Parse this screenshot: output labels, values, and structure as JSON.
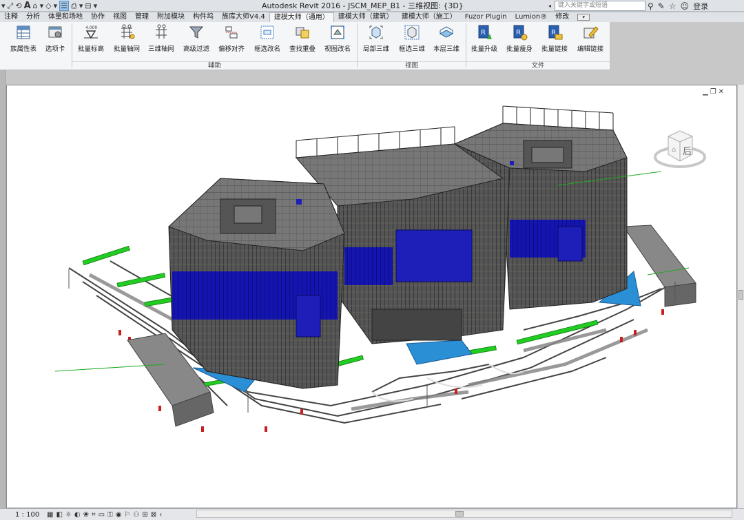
{
  "window": {
    "title": "Autodesk Revit 2016 -     JSCM_MEP_B1 - 三维视图: {3D}",
    "search_placeholder": "键入关键字或短语",
    "login_label": "登录"
  },
  "qat": [
    "▾",
    "⤢",
    "⟲",
    "A",
    "⌂",
    "▾",
    "◇",
    "▾",
    "☰",
    "⎙",
    "▾",
    "⊟",
    "▾"
  ],
  "tabs": [
    {
      "label": "注释"
    },
    {
      "label": "分析"
    },
    {
      "label": "体量和场地"
    },
    {
      "label": "协作"
    },
    {
      "label": "视图"
    },
    {
      "label": "管理"
    },
    {
      "label": "附加模块"
    },
    {
      "label": "构件坞"
    },
    {
      "label": "族库大师V4.4"
    },
    {
      "label": "建模大师（通用）",
      "active": true
    },
    {
      "label": "建模大师（建筑）"
    },
    {
      "label": "建模大师（施工）"
    },
    {
      "label": "Fuzor Plugin"
    },
    {
      "label": "Lumion®"
    },
    {
      "label": "修改"
    }
  ],
  "ribbon": {
    "buttons": [
      {
        "label": "族属性表",
        "icon": "table-icon"
      },
      {
        "label": "选项卡",
        "icon": "settings-panel-icon"
      },
      {
        "label": "批量标高",
        "icon": "level-icon",
        "badge": "4.000"
      },
      {
        "label": "批量轴网",
        "icon": "grid-icon"
      },
      {
        "label": "三维轴网",
        "icon": "grid-3d-icon"
      },
      {
        "label": "高级过滤",
        "icon": "filter-icon"
      },
      {
        "label": "偏移对齐",
        "icon": "align-icon"
      },
      {
        "label": "框选改名",
        "icon": "rename-icon"
      },
      {
        "label": "查找重叠",
        "icon": "overlap-icon"
      },
      {
        "label": "视图改名",
        "icon": "view-rename-icon"
      },
      {
        "label": "局部三维",
        "icon": "local-3d-icon"
      },
      {
        "label": "框选三维",
        "icon": "box-3d-icon"
      },
      {
        "label": "本层三维",
        "icon": "floor-3d-icon"
      },
      {
        "label": "批量升级",
        "icon": "upgrade-icon"
      },
      {
        "label": "批量瘦身",
        "icon": "slim-icon"
      },
      {
        "label": "批量链接",
        "icon": "link-icon"
      },
      {
        "label": "编辑链接",
        "icon": "edit-link-icon"
      }
    ],
    "panels": [
      {
        "label": "辅助"
      },
      {
        "label": "视图"
      },
      {
        "label": "文件"
      }
    ]
  },
  "viewcube": {
    "face_label": "后"
  },
  "status": {
    "scale": "1 : 100"
  },
  "colors": {
    "accent_blue": "#1e1eb8",
    "pipe_green": "#22cc22",
    "structure_gray": "#6f6f6f",
    "light_blue": "#2b8fd6"
  }
}
